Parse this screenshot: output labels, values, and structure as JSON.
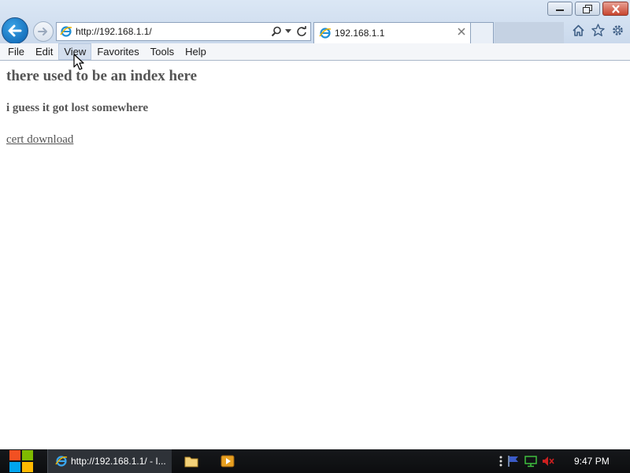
{
  "browser": {
    "address_url": "http://192.168.1.1/",
    "tab_title": "192.168.1.1"
  },
  "menu": {
    "items": [
      "File",
      "Edit",
      "View",
      "Favorites",
      "Tools",
      "Help"
    ]
  },
  "page": {
    "heading": "there used to be an index here",
    "subheading": "i guess it got lost somewhere",
    "link_text": "cert download"
  },
  "taskbar": {
    "ie_task_label": "http://192.168.1.1/ - I...",
    "clock": "9:47 PM"
  },
  "colors": {
    "page_text": "#555555",
    "taskbar": "#0c0d0f",
    "close_button": "#c8452f"
  }
}
